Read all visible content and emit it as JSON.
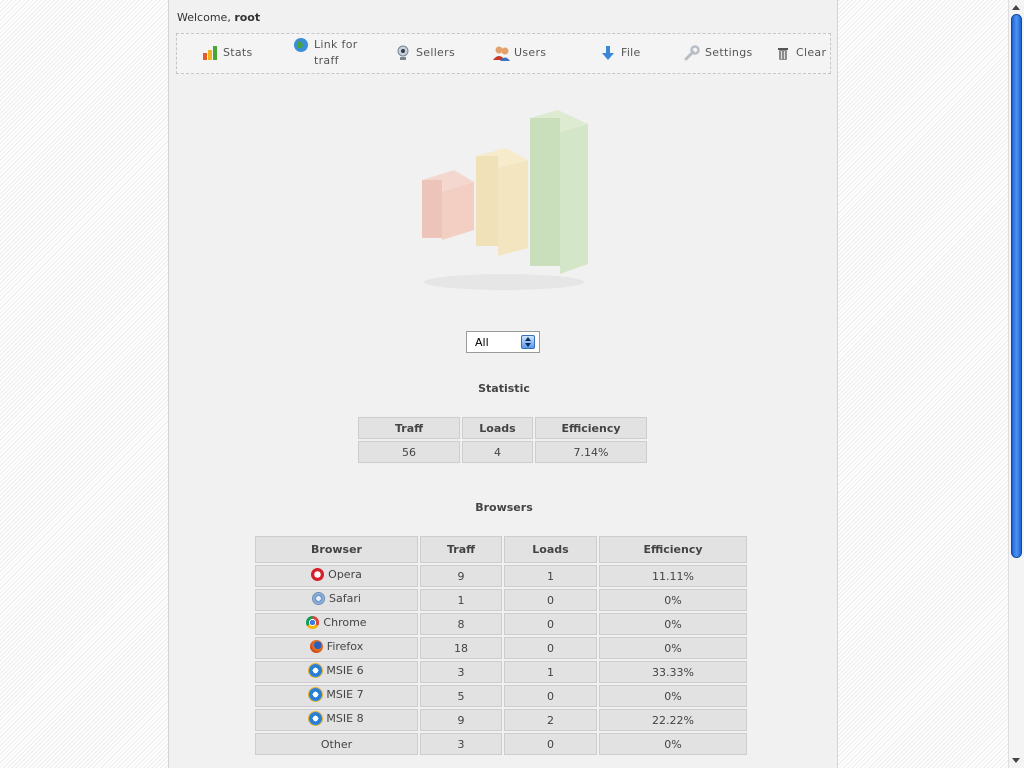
{
  "welcome": {
    "prefix": "Welcome, ",
    "user": "root"
  },
  "menu": [
    {
      "label": "Stats",
      "icon": "bar-chart-icon"
    },
    {
      "label": "Link for",
      "label2": "traff",
      "icon": "globe-icon"
    },
    {
      "label": "Sellers",
      "icon": "webcam-icon"
    },
    {
      "label": "Users",
      "icon": "users-icon"
    },
    {
      "label": "File",
      "icon": "download-arrow-icon"
    },
    {
      "label": "Settings",
      "icon": "wrench-icon"
    },
    {
      "label": "Clear",
      "icon": "trash-can-icon"
    }
  ],
  "filter": {
    "selected": "All"
  },
  "statistic": {
    "title": "Statistic",
    "headers": [
      "Traff",
      "Loads",
      "Efficiency"
    ],
    "row": [
      "56",
      "4",
      "7.14%"
    ]
  },
  "browsers": {
    "title": "Browsers",
    "headers": [
      "Browser",
      "Traff",
      "Loads",
      "Efficiency"
    ],
    "rows": [
      {
        "name": "Opera",
        "icon": "opera-icon",
        "traff": "9",
        "loads": "1",
        "eff": "11.11%"
      },
      {
        "name": "Safari",
        "icon": "safari-icon",
        "traff": "1",
        "loads": "0",
        "eff": "0%"
      },
      {
        "name": "Chrome",
        "icon": "chrome-icon",
        "traff": "8",
        "loads": "0",
        "eff": "0%"
      },
      {
        "name": "Firefox",
        "icon": "firefox-icon",
        "traff": "18",
        "loads": "0",
        "eff": "0%"
      },
      {
        "name": "MSIE 6",
        "icon": "ie-icon",
        "traff": "3",
        "loads": "1",
        "eff": "33.33%"
      },
      {
        "name": "MSIE 7",
        "icon": "ie-icon",
        "traff": "5",
        "loads": "0",
        "eff": "0%"
      },
      {
        "name": "MSIE 8",
        "icon": "ie-icon",
        "traff": "9",
        "loads": "2",
        "eff": "22.22%"
      },
      {
        "name": "Other",
        "icon": "",
        "traff": "3",
        "loads": "0",
        "eff": "0%"
      }
    ]
  }
}
